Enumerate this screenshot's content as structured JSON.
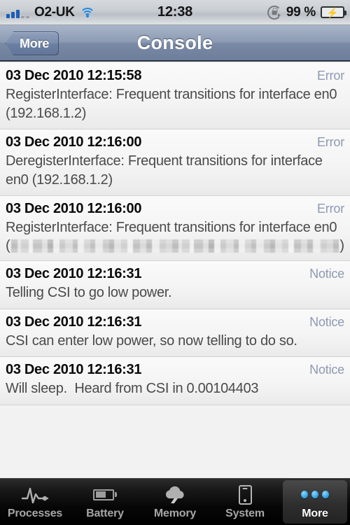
{
  "status_bar": {
    "carrier": "O2-UK",
    "clock": "12:38",
    "battery_percent": "99 %",
    "signal_bars_filled": 3,
    "signal_bars_empty": 2,
    "icons": [
      "signal-icon",
      "wifi-icon",
      "rotation-lock-icon",
      "battery-charging-icon"
    ]
  },
  "nav_bar": {
    "back_label": "More",
    "title": "Console"
  },
  "log": {
    "entries": [
      {
        "timestamp": "03 Dec 2010 12:15:58",
        "level": "Error",
        "message": "RegisterInterface: Frequent transitions for interface en0 (192.168.1.2)",
        "redacted": false
      },
      {
        "timestamp": "03 Dec 2010 12:16:00",
        "level": "Error",
        "message": "DeregisterInterface: Frequent transitions for interface en0 (192.168.1.2)",
        "redacted": false
      },
      {
        "timestamp": "03 Dec 2010 12:16:00",
        "level": "Error",
        "message": "RegisterInterface: Frequent transitions for interface en0",
        "redacted": true,
        "redacted_prefix": "(",
        "redacted_suffix": ")"
      },
      {
        "timestamp": "03 Dec 2010 12:16:31",
        "level": "Notice",
        "message": "Telling CSI to go low power.",
        "redacted": false
      },
      {
        "timestamp": "03 Dec 2010 12:16:31",
        "level": "Notice",
        "message": "CSI can enter low power, so now telling to do so.",
        "redacted": false
      },
      {
        "timestamp": "03 Dec 2010 12:16:31",
        "level": "Notice",
        "message": "Will sleep.  Heard from CSI in 0.00104403",
        "redacted": false
      }
    ]
  },
  "tab_bar": {
    "tabs": [
      {
        "label": "Processes",
        "icon": "pulse-icon",
        "selected": false
      },
      {
        "label": "Battery",
        "icon": "battery-icon",
        "selected": false
      },
      {
        "label": "Memory",
        "icon": "cloud-bolt-icon",
        "selected": false
      },
      {
        "label": "System",
        "icon": "phone-icon",
        "selected": false
      },
      {
        "label": "More",
        "icon": "three-dots-icon",
        "selected": true
      }
    ]
  },
  "colors": {
    "nav_bar": "#7a8aa5",
    "level_text": "#8d9ab3",
    "tab_accent": "#3aa8ea",
    "battery_green": "#46c91d"
  }
}
